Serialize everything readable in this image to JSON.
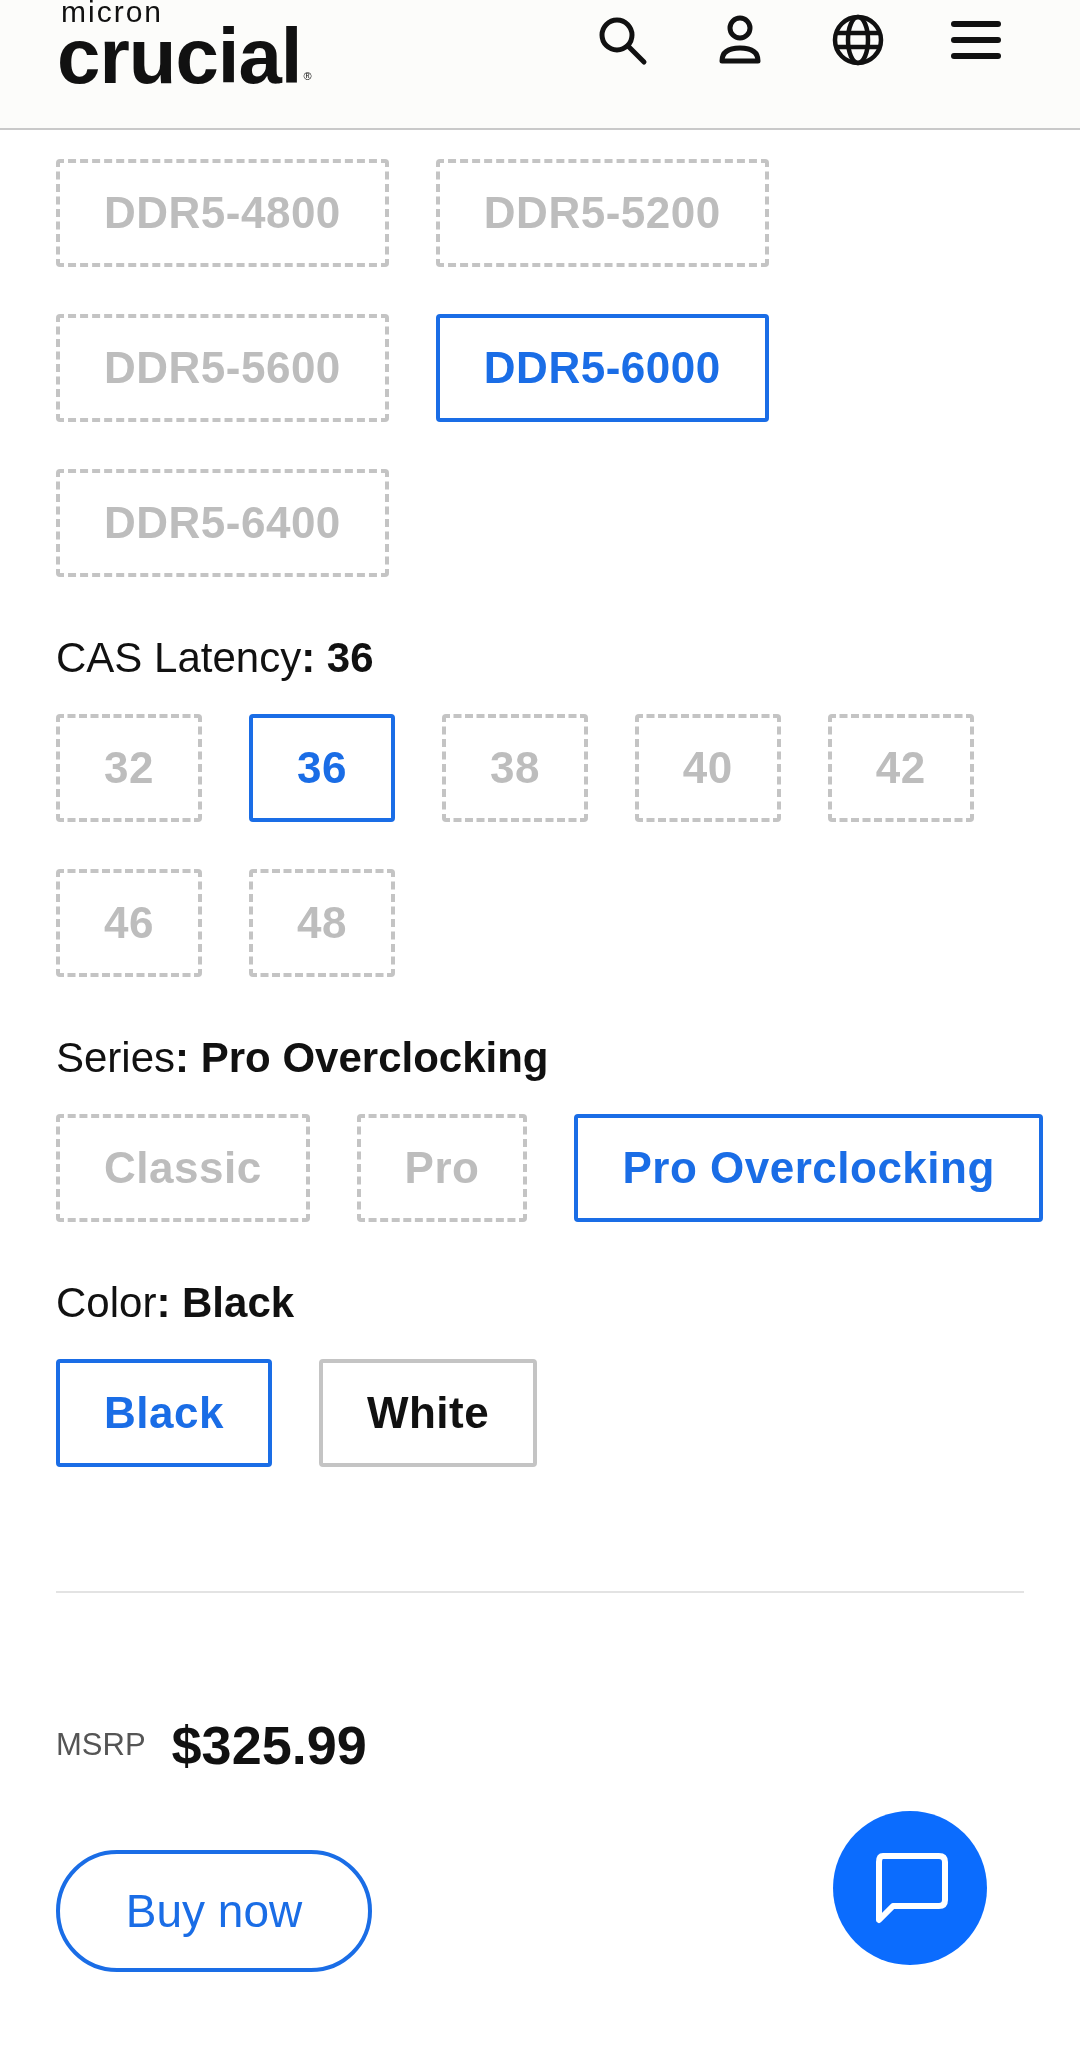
{
  "header": {
    "logo": {
      "parent_brand": "micron",
      "wordmark": "crucial",
      "registered_mark": "®"
    }
  },
  "option_groups": [
    {
      "options": [
        {
          "label": "DDR5-4800",
          "selected": false,
          "disabled": true
        },
        {
          "label": "DDR5-5200",
          "selected": false,
          "disabled": true
        },
        {
          "label": "DDR5-5600",
          "selected": false,
          "disabled": true
        },
        {
          "label": "DDR5-6000",
          "selected": true,
          "disabled": false
        },
        {
          "label": "DDR5-6400",
          "selected": false,
          "disabled": true
        }
      ]
    },
    {
      "label": "CAS Latency**: 36**",
      "options": [
        {
          "label": "32",
          "selected": false,
          "disabled": true
        },
        {
          "label": "36",
          "selected": true,
          "disabled": false
        },
        {
          "label": "38",
          "selected": false,
          "disabled": true
        },
        {
          "label": "40",
          "selected": false,
          "disabled": true
        },
        {
          "label": "42",
          "selected": false,
          "disabled": true
        },
        {
          "label": "46",
          "selected": false,
          "disabled": true
        },
        {
          "label": "48",
          "selected": false,
          "disabled": true
        }
      ]
    },
    {
      "label": "Series**: Pro Overclocking**",
      "options": [
        {
          "label": "Classic",
          "selected": false,
          "disabled": true
        },
        {
          "label": "Pro",
          "selected": false,
          "disabled": true
        },
        {
          "label": "Pro Overclocking",
          "selected": true,
          "disabled": false
        }
      ]
    },
    {
      "label": "Color**: Black**",
      "options": [
        {
          "label": "Black",
          "selected": true,
          "disabled": false
        },
        {
          "label": "White",
          "selected": false,
          "disabled": false
        }
      ]
    }
  ],
  "purchase": {
    "msrp_label": "MSRP",
    "price": "$325.99",
    "buy_button": "Buy now"
  }
}
